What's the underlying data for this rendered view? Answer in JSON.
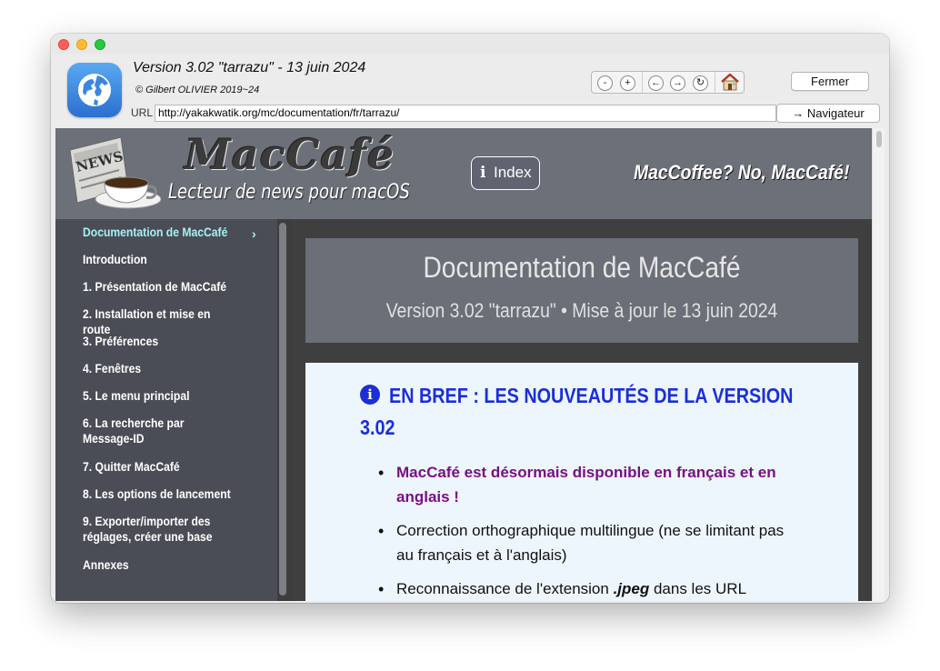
{
  "window": {
    "title": "Version 3.02 \"tarrazu\" - 13 juin 2024",
    "copyright": "© Gilbert OLIVIER 2019~24"
  },
  "toolbar": {
    "zoom_out": "-",
    "zoom_in": "+",
    "back": "←",
    "forward": "→",
    "reload": "↻",
    "home_icon": "house-icon",
    "close_label": "Fermer",
    "url_label": "URL",
    "url_value": "http://yakakwatik.org/mc/documentation/fr/tarrazu/",
    "browser_label": "→ Navigateur"
  },
  "banner": {
    "logo_title": "MacCafé",
    "logo_subtitle": "Lecteur de news pour macOS",
    "index_label": "Index",
    "slogan": "MacCoffee? No, MacCafé!"
  },
  "sidebar": {
    "items": [
      {
        "label": "Documentation de MacCafé"
      },
      {
        "label": "Introduction"
      },
      {
        "label": "1. Présentation de MacCafé"
      },
      {
        "label": "2. Installation et mise en route"
      },
      {
        "label": "3. Préférences"
      },
      {
        "label": "4. Fenêtres"
      },
      {
        "label": "5. Le menu principal"
      },
      {
        "label": "6. La recherche par Message-ID"
      },
      {
        "label": "7. Quitter MacCafé"
      },
      {
        "label": "8. Les options de lancement"
      },
      {
        "label": "9. Exporter/importer des réglages, créer une base"
      },
      {
        "label": "Annexes"
      }
    ],
    "chevron": "›"
  },
  "doc": {
    "title": "Documentation de MacCafé",
    "subtitle": "Version 3.02 \"tarrazu\" • Mise à jour le 13 juin 2024",
    "bref_heading_1": "EN BREF : LES NOUVEAUTÉS DE LA VERSION",
    "bref_heading_2": "3.02",
    "bullet_1": "MacCafé est désormais disponible en français et en anglais !",
    "bullet_2": "Correction orthographique multilingue (ne se limitant pas au français et à l'anglais)",
    "bullet_3_pre": "Reconnaissance de l'extension ",
    "bullet_3_em": ".jpeg",
    "bullet_3_post": " dans les URL"
  },
  "colors": {
    "banner": "#6c7079",
    "sidebar": "#4a4d55",
    "active_link": "#a8f0f5",
    "heading_blue": "#1a2fd8",
    "highlight_purple": "#7a0e86",
    "doc_body": "#eef6fd"
  }
}
